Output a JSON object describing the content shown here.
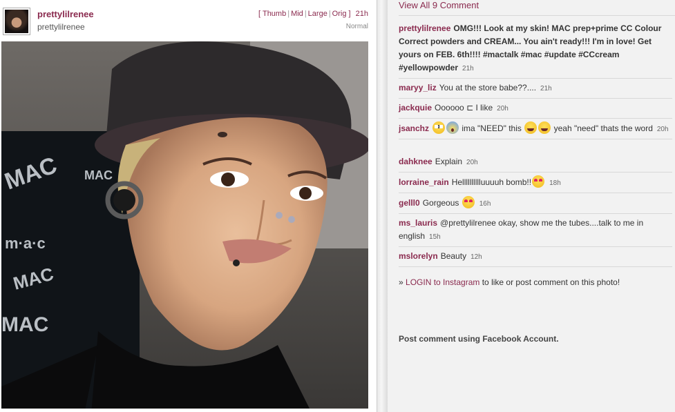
{
  "post": {
    "username": "prettylilrenee",
    "fullname": "prettylilrenee",
    "size_links": [
      "Thumb",
      "Mid",
      "Large",
      "Orig"
    ],
    "time": "21h",
    "filter": "Normal"
  },
  "comments_header": {
    "view_all": "View All 9 Comment"
  },
  "caption": {
    "user": "prettylilrenee",
    "text": "OMG!!! Look at my skin! MAC prep+prime CC Colour Correct powders and CREAM... You ain't ready!!! I'm in love! Get yours on FEB. 6th!!!! ",
    "tags": "#mactalk #mac #update #CCcream #yellowpowder",
    "time": "21h"
  },
  "comments": [
    {
      "user": "maryy_liz",
      "text": "You at the store babe??....",
      "time": "21h"
    },
    {
      "user": "jackquie",
      "text": "Oooooo ⊏ I like",
      "time": "20h"
    },
    {
      "user": "jsanchz",
      "text_a": "ima \"NEED\" this",
      "text_b": "yeah \"need\" thats the word",
      "time": "20h"
    },
    {
      "user": "dahknee",
      "text": "Explain",
      "time": "20h"
    },
    {
      "user": "lorraine_rain",
      "text": "Helllllllllluuuuh bomb!!",
      "time": "18h"
    },
    {
      "user": "gelll0",
      "text": "Gorgeous",
      "time": "16h"
    },
    {
      "user": "ms_lauris",
      "text": "@prettylilrenee okay, show me the tubes....talk to me in english",
      "time": "15h"
    },
    {
      "user": "mslorelyn",
      "text": "Beauty",
      "time": "12h"
    }
  ],
  "login": {
    "prefix": "» ",
    "link": "LOGIN to Instagram",
    "suffix": " to like or post comment on this photo!"
  },
  "facebook_comment": "Post comment using Facebook Account.",
  "colors": {
    "accent": "#8a2a4e",
    "panel": "#f2f2f2"
  }
}
